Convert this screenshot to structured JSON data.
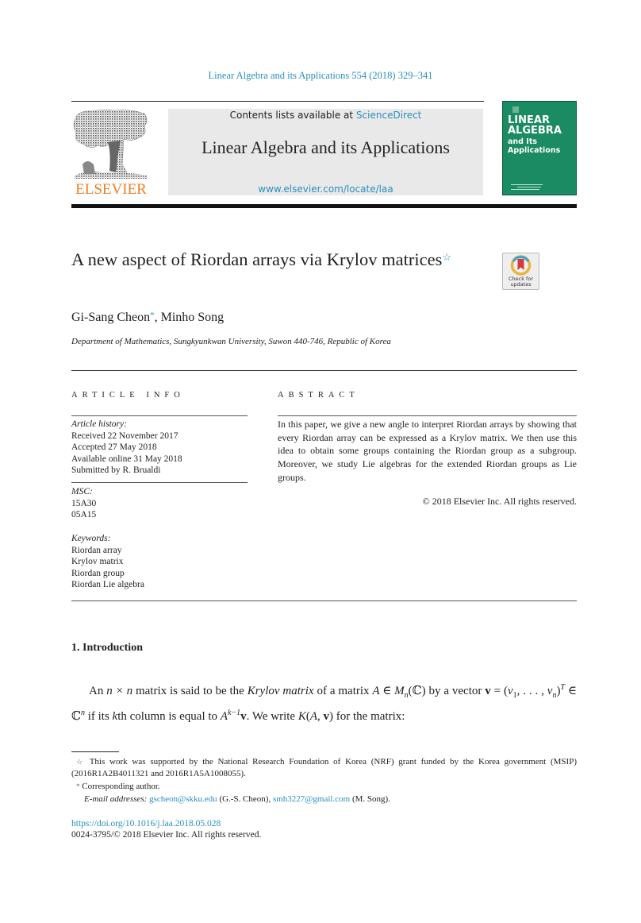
{
  "header": {
    "journal_reference": "Linear Algebra and its Applications 554 (2018) 329–341",
    "contents_prefix": "Contents lists available at ",
    "contents_link": "ScienceDirect",
    "journal_title": "Linear Algebra and its Applications",
    "journal_url": "www.elsevier.com/locate/laa",
    "publisher_logo_text": "ELSEVIER",
    "cover": {
      "line1": "LINEAR",
      "line2": "ALGEBRA",
      "line3": "and Its",
      "line4": "Applications",
      "color": "#1a8b63"
    },
    "accent_color": "#2a8fbd",
    "publisher_color": "#f07f24"
  },
  "article": {
    "title": "A new aspect of Riordan arrays via Krylov matrices",
    "title_footnote_mark": "☆",
    "check_updates_label": "Check for updates",
    "authors": {
      "author1": "Gi-Sang Cheon",
      "author1_mark": "*",
      "separator": ", ",
      "author2": "Minho Song"
    },
    "affiliation": "Department of Mathematics, Sungkyunkwan University, Suwon 440-746, Republic of Korea"
  },
  "article_info": {
    "heading": "ARTICLE INFO",
    "history_label": "Article history:",
    "history": [
      "Received 22 November 2017",
      "Accepted 27 May 2018",
      "Available online 31 May 2018",
      "Submitted by R. Brualdi"
    ],
    "msc_label": "MSC:",
    "msc": [
      "15A30",
      "05A15"
    ],
    "keywords_label": "Keywords:",
    "keywords": [
      "Riordan array",
      "Krylov matrix",
      "Riordan group",
      "Riordan Lie algebra"
    ]
  },
  "abstract": {
    "heading": "ABSTRACT",
    "text": "In this paper, we give a new angle to interpret Riordan arrays by showing that every Riordan array can be expressed as a Krylov matrix. We then use this idea to obtain some groups containing the Riordan group as a subgroup. Moreover, we study Lie algebras for the extended Riordan groups as Lie groups.",
    "copyright": "© 2018 Elsevier Inc. All rights reserved."
  },
  "section": {
    "heading": "1.  Introduction",
    "para": {
      "p1": "An ",
      "m1": "n × n",
      "p2": " matrix is said to be the ",
      "term": "Krylov matrix",
      "p3": " of a matrix ",
      "m2": "A ∈ M",
      "m2sub": "n",
      "m2b": "(ℂ)",
      "p4": " by a vector ",
      "v": "v",
      "p5": " = (",
      "v1": "v",
      "v1sub": "1",
      "p6": ", . . . , ",
      "vn": "v",
      "vnsub": "n",
      "p7": ")",
      "sup_T": "T",
      "p8": " ∈ ℂ",
      "sup_n": "n",
      "p9": " if its ",
      "k": "k",
      "p10": "th column is equal to ",
      "A": "A",
      "sup_k": "k−1",
      "v2": "v",
      "p11": ". We write ",
      "K": "K",
      "p12": "(",
      "A2": "A",
      "p13": ", ",
      "v3": "v",
      "p14": ") for the matrix:"
    }
  },
  "footnotes": {
    "fn1_mark": "☆",
    "fn1": "This work was supported by the National Research Foundation of Korea (NRF) grant funded by the Korea government (MSIP) (2016R1A2B4011321 and 2016R1A5A1008055).",
    "fn2_mark": "*",
    "fn2": "Corresponding author.",
    "email_label": "E-mail addresses:",
    "email1": "gscheon@skku.edu",
    "email1_who": " (G.-S. Cheon), ",
    "email2": "smh3227@gmail.com",
    "email2_who": " (M. Song)."
  },
  "footer": {
    "doi": "https://doi.org/10.1016/j.laa.2018.05.028",
    "issn": "0024-3795/© 2018 Elsevier Inc. All rights reserved."
  }
}
